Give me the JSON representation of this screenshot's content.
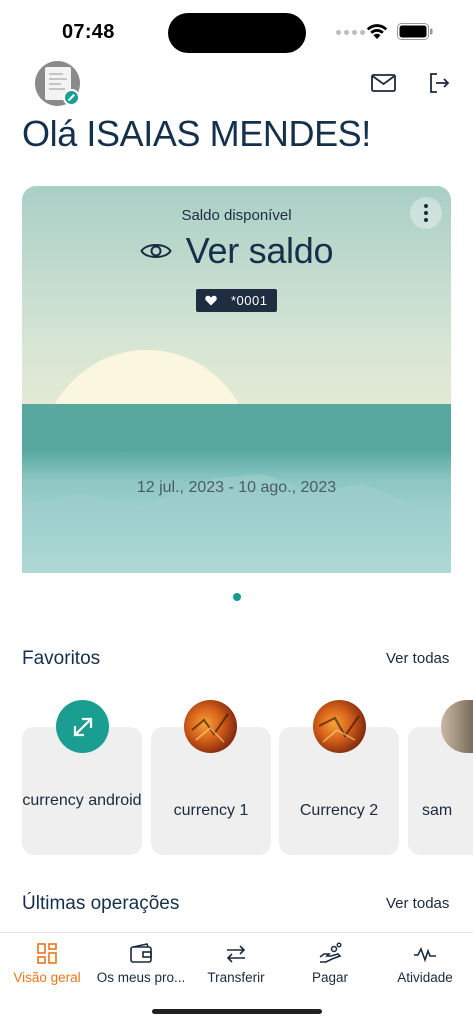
{
  "status_bar": {
    "time": "07:48"
  },
  "header": {
    "greeting": "Olá ISAIAS MENDES!",
    "icons": [
      "avatar",
      "pencil-icon",
      "mail-icon",
      "logout-icon"
    ]
  },
  "balance_card": {
    "label": "Saldo disponível",
    "value": "Ver saldo",
    "account_suffix": "*0001",
    "date_range": "12 jul., 2023 - 10 ago., 2023",
    "icons": [
      "eye-icon",
      "heart-icon",
      "more-vertical-icon"
    ]
  },
  "favorites": {
    "title": "Favoritos",
    "see_all": "Ver todas",
    "items": [
      {
        "label": "currency android",
        "icon": "transfer-arrows-icon"
      },
      {
        "label": "currency 1",
        "icon": "fire-photo"
      },
      {
        "label": "Currency 2",
        "icon": "fire-photo"
      },
      {
        "label": "sam",
        "icon": "photo"
      }
    ]
  },
  "operations": {
    "title": "Últimas operações",
    "see_all": "Ver todas"
  },
  "bottom_nav": {
    "items": [
      {
        "label": "Visão geral",
        "icon": "dashboard-icon",
        "active": true
      },
      {
        "label": "Os meus pro...",
        "icon": "wallet-icon",
        "active": false
      },
      {
        "label": "Transferir",
        "icon": "transfer-icon",
        "active": false
      },
      {
        "label": "Pagar",
        "icon": "pay-icon",
        "active": false
      },
      {
        "label": "Atividade",
        "icon": "activity-icon",
        "active": false
      }
    ]
  },
  "colors": {
    "accent_teal": "#1a9e91",
    "active_orange": "#e8761c",
    "title_navy": "#15304b"
  }
}
